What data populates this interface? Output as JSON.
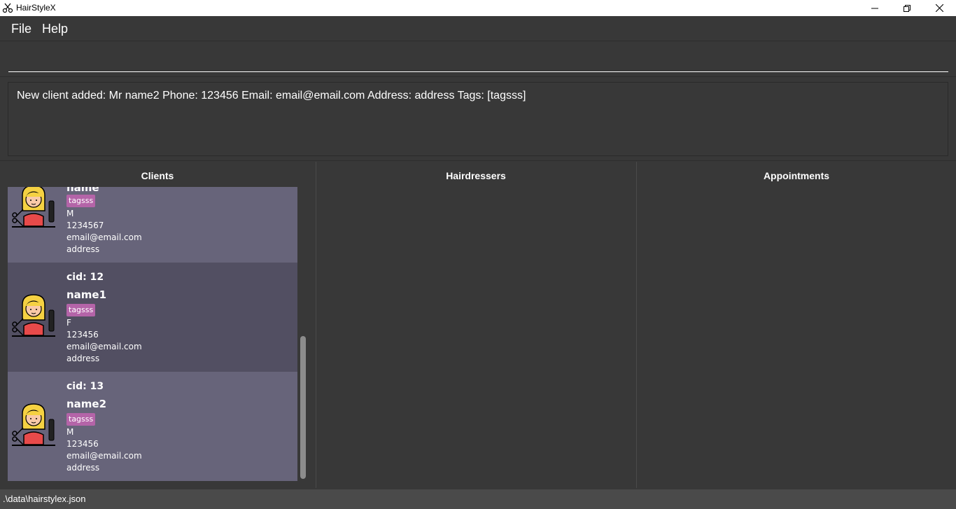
{
  "window": {
    "title": "HairStyleX",
    "icons": {
      "app": "scissors-icon",
      "minimize": "minimize-icon",
      "maximize": "restore-icon",
      "close": "close-icon"
    }
  },
  "menu": {
    "file": "File",
    "help": "Help"
  },
  "command": {
    "value": "",
    "placeholder": ""
  },
  "result": {
    "text": "New client added: Mr name2 Phone: 123456 Email: email@email.com Address: address Tags: [tagsss]"
  },
  "panels": {
    "clients": "Clients",
    "hairdressers": "Hairdressers",
    "appointments": "Appointments"
  },
  "clients": [
    {
      "name": "name",
      "tag": "tagsss",
      "gender": "M",
      "phone": "1234567",
      "email": "email@email.com",
      "address": "address"
    },
    {
      "cid": "cid: 12",
      "name": "name1",
      "tag": "tagsss",
      "gender": "F",
      "phone": "123456",
      "email": "email@email.com",
      "address": "address"
    },
    {
      "cid": "cid: 13",
      "name": "name2",
      "tag": "tagsss",
      "gender": "M",
      "phone": "123456",
      "email": "email@email.com",
      "address": "address"
    }
  ],
  "status": {
    "path": ".\\data\\hairstylex.json"
  },
  "colors": {
    "background": "#383838",
    "card_light": "#67647a",
    "card_dark": "#524f62",
    "tag": "#b464a8",
    "status_bar": "#4a4a4a"
  }
}
